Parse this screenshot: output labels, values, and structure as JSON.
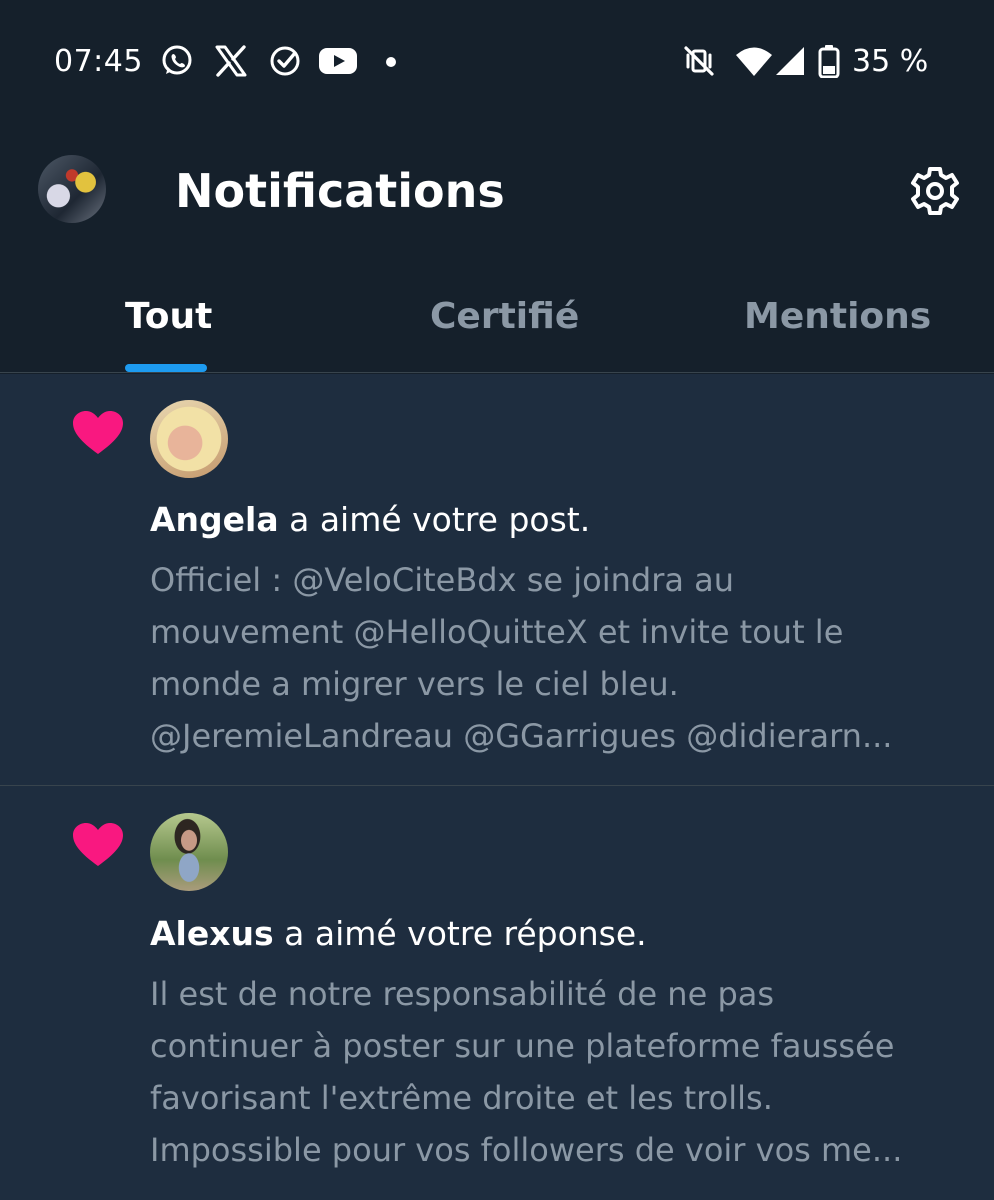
{
  "status_bar": {
    "time": "07:45",
    "app_icons": [
      "whatsapp-icon",
      "x-icon",
      "check-circle-icon",
      "youtube-icon"
    ],
    "system_icons": [
      "mute-vibrate-icon",
      "wifi-icon",
      "cellular-signal-icon",
      "battery-icon"
    ],
    "battery_percent": "35 %"
  },
  "header": {
    "title": "Notifications"
  },
  "tabs": [
    {
      "label": "Tout",
      "active": true
    },
    {
      "label": "Certifié",
      "active": false
    },
    {
      "label": "Mentions",
      "active": false
    }
  ],
  "notifications": [
    {
      "type": "like",
      "name": "Angela",
      "action": " a aimé votre post.",
      "text_lines": [
        "Officiel : @VeloCiteBdx se joindra au",
        "mouvement @HelloQuitteX et invite tout le",
        "monde a migrer vers le ciel bleu.",
        "@JeremieLandreau @GGarrigues @didierarn..."
      ]
    },
    {
      "type": "like",
      "name": "Alexus",
      "action": " a aimé votre réponse.",
      "text_lines": [
        "Il est de notre responsabilité de ne pas",
        "continuer à poster sur une plateforme faussée",
        "favorisant l'extrême droite et les trolls.",
        "Impossible pour vos followers de voir vos me..."
      ]
    }
  ],
  "colors": {
    "background": "#15202b",
    "feed_background": "#1e2d3f",
    "accent": "#1d9bf0",
    "heart": "#f91880",
    "muted_text": "#8b98a5"
  }
}
